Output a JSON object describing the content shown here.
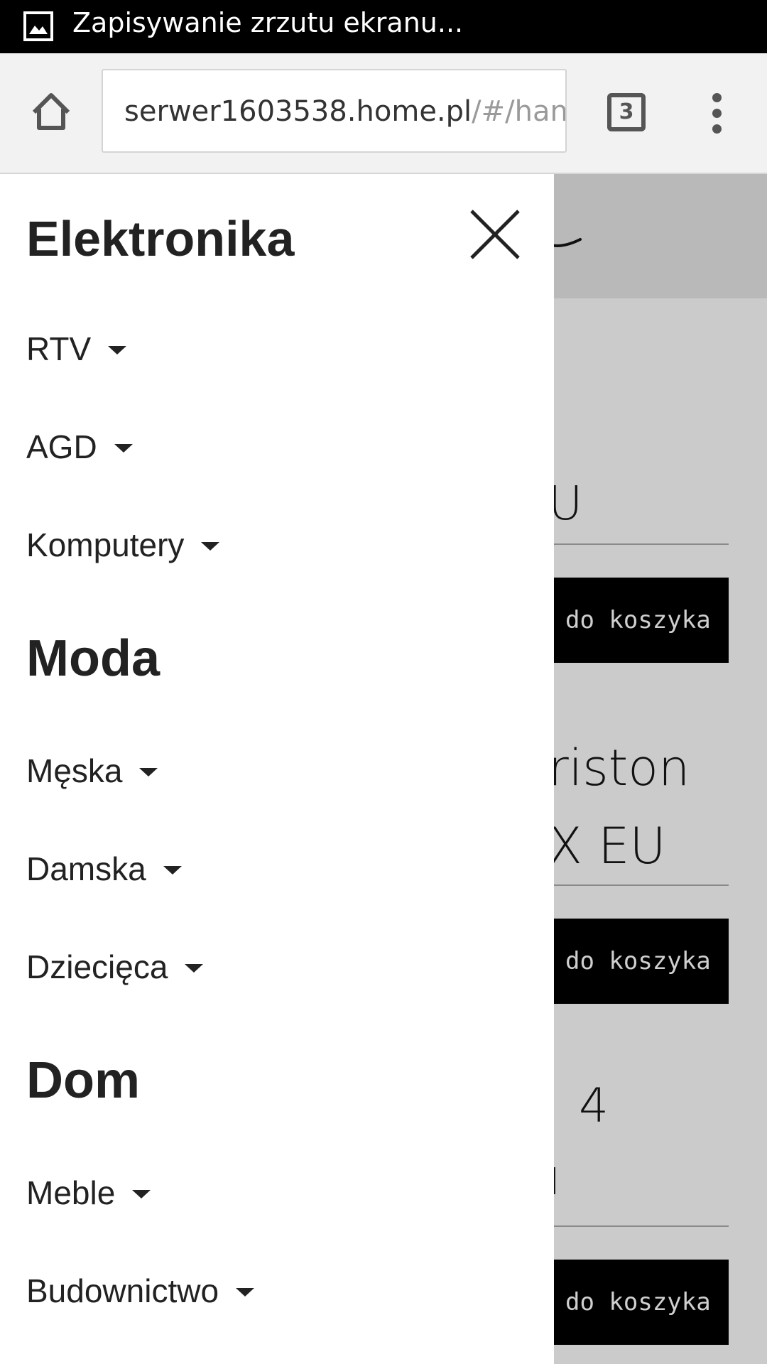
{
  "status_bar": {
    "icon": "screenshot-image-icon",
    "text": "Zapisywanie zrzutu ekranu..."
  },
  "browser": {
    "home_icon": "home-icon",
    "url_host": "serwer1603538.home.pl",
    "url_path": "/#/han",
    "tab_count": "3",
    "menu_icon": "more-vertical-icon"
  },
  "drawer": {
    "close_icon": "close-icon",
    "sections": [
      {
        "heading": "Elektronika",
        "items": [
          "RTV",
          "AGD",
          "Komputery"
        ]
      },
      {
        "heading": "Moda",
        "items": [
          "Męska",
          "Damska",
          "Dziecięca"
        ]
      },
      {
        "heading": "Dom",
        "items": [
          "Meble",
          "Budownictwo"
        ]
      }
    ]
  },
  "background_page": {
    "product_fragments": [
      "U",
      "riston",
      "X  EU",
      "4",
      "l"
    ],
    "add_to_cart_label": "do koszyka"
  }
}
